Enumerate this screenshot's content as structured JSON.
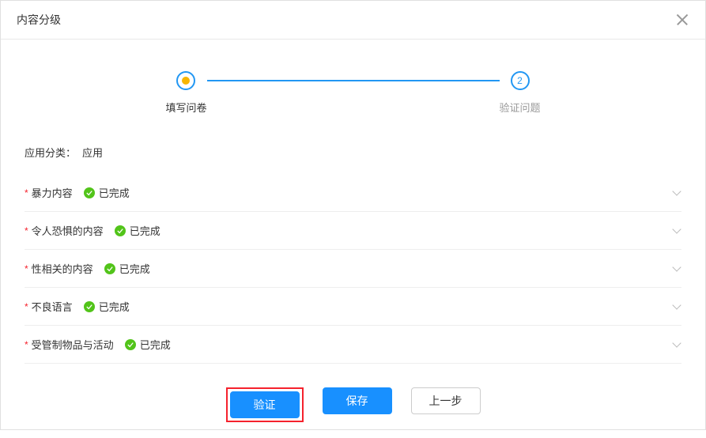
{
  "header": {
    "title": "内容分级"
  },
  "stepper": {
    "steps": [
      {
        "label": "填写问卷",
        "state": "active"
      },
      {
        "label": "验证问题",
        "state": "pending",
        "number": "2"
      }
    ]
  },
  "category": {
    "label": "应用分类：",
    "value": "应用"
  },
  "status_text": "已完成",
  "items": [
    {
      "title": "暴力内容",
      "status": "done"
    },
    {
      "title": "令人恐惧的内容",
      "status": "done"
    },
    {
      "title": "性相关的内容",
      "status": "done"
    },
    {
      "title": "不良语言",
      "status": "done"
    },
    {
      "title": "受管制物品与活动",
      "status": "done"
    }
  ],
  "footer": {
    "verify_label": "验证",
    "save_label": "保存",
    "back_label": "上一步"
  }
}
